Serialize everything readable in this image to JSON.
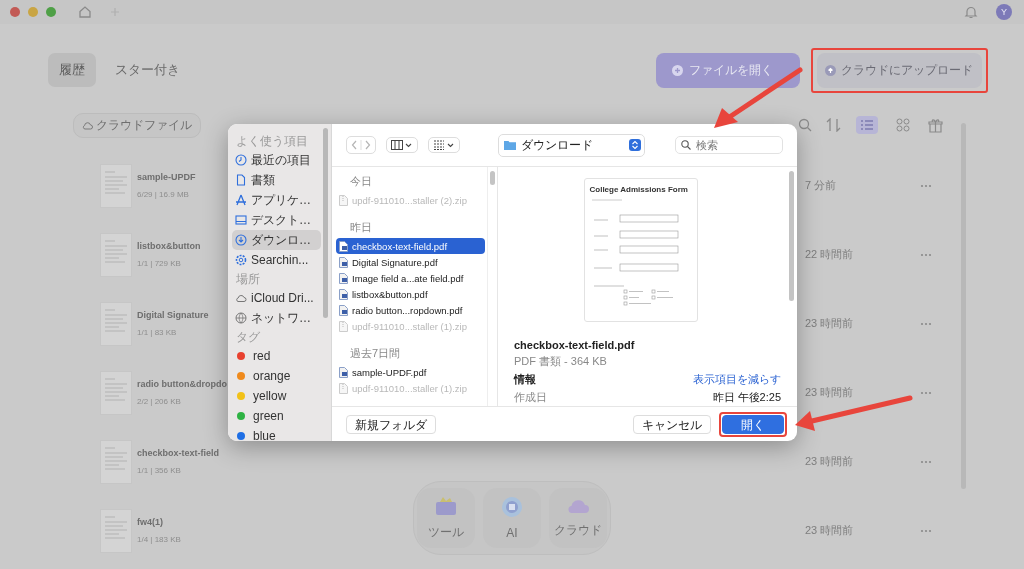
{
  "titlebar": {
    "avatar": "Y"
  },
  "tabs": [
    {
      "label": "履歴",
      "selected": true
    },
    {
      "label": "スター付き",
      "selected": false
    }
  ],
  "actions": [
    {
      "label": "ファイルを開く",
      "kind": "primary",
      "highlighted": false
    },
    {
      "label": "クラウドにアップロード",
      "kind": "secondary",
      "highlighted": true
    }
  ],
  "cloud_files": "クラウドファイル",
  "view_modes": [
    {
      "kind": "list",
      "selected": true
    },
    {
      "kind": "grid",
      "selected": false
    }
  ],
  "files": [
    {
      "name": "sample-UPDF",
      "meta": "6/29 | 16.9 MB",
      "time": "7 分前"
    },
    {
      "name": "listbox&button",
      "meta": "1/1 | 729 KB",
      "time": "22 時間前"
    },
    {
      "name": "Digital Signature",
      "meta": "1/1 | 83 KB",
      "time": "23 時間前"
    },
    {
      "name": "radio button&dropdo",
      "meta": "2/2 | 206 KB",
      "time": "23 時間前"
    },
    {
      "name": "checkbox-text-field",
      "meta": "1/1 | 356 KB",
      "time": "23 時間前"
    },
    {
      "name": "fw4(1)",
      "meta": "1/4 | 183 KB",
      "time": "23 時間前"
    }
  ],
  "dock": [
    {
      "label": "ツール",
      "kind": "tools"
    },
    {
      "label": "AI",
      "kind": "ai"
    },
    {
      "label": "クラウド",
      "kind": "cloud"
    }
  ],
  "dialog": {
    "sidebar": [
      {
        "heading": "よく使う項目",
        "items": [
          {
            "label": "最近の項目",
            "kind": "clock",
            "selected": false
          },
          {
            "label": "書類",
            "kind": "document",
            "selected": false
          },
          {
            "label": "アプリケ…",
            "kind": "apps",
            "selected": false
          },
          {
            "label": "デスクト…",
            "kind": "desktop",
            "selected": false
          },
          {
            "label": "ダウンロ…",
            "kind": "download",
            "selected": true
          },
          {
            "label": "Searchin...",
            "kind": "gear",
            "selected": false
          }
        ]
      },
      {
        "heading": "場所",
        "items": [
          {
            "label": "iCloud Dri...",
            "kind": "cloud",
            "selected": false
          },
          {
            "label": "ネットワ…",
            "kind": "globe",
            "selected": false
          }
        ]
      },
      {
        "heading": "タグ",
        "items": [
          {
            "label": "red",
            "kind": "tag",
            "color": "#e8412f",
            "selected": false
          },
          {
            "label": "orange",
            "kind": "tag",
            "color": "#ef8a1c",
            "selected": false
          },
          {
            "label": "yellow",
            "kind": "tag",
            "color": "#f2c118",
            "selected": false
          },
          {
            "label": "green",
            "kind": "tag",
            "color": "#2fb344",
            "selected": false
          },
          {
            "label": "blue",
            "kind": "tag",
            "color": "#1f6fe5",
            "selected": false
          }
        ]
      }
    ],
    "location": "ダウンロード",
    "search_placeholder": "検索",
    "groups": [
      {
        "heading": "今日",
        "files": [
          {
            "name": "updf-911010...staller (2).zip",
            "kind": "zip",
            "disabled": true,
            "selected": false
          }
        ]
      },
      {
        "heading": "昨日",
        "files": [
          {
            "name": "checkbox-text-field.pdf",
            "kind": "pdf",
            "disabled": false,
            "selected": true
          },
          {
            "name": "Digital Signature.pdf",
            "kind": "pdf",
            "disabled": false,
            "selected": false
          },
          {
            "name": "Image field a...ate field.pdf",
            "kind": "pdf",
            "disabled": false,
            "selected": false
          },
          {
            "name": "listbox&button.pdf",
            "kind": "pdf",
            "disabled": false,
            "selected": false
          },
          {
            "name": "radio button...ropdown.pdf",
            "kind": "pdf",
            "disabled": false,
            "selected": false
          },
          {
            "name": "updf-911010...staller (1).zip",
            "kind": "zip",
            "disabled": true,
            "selected": false
          }
        ]
      },
      {
        "heading": "過去7日間",
        "files": [
          {
            "name": "sample-UPDF.pdf",
            "kind": "pdf",
            "disabled": false,
            "selected": false
          },
          {
            "name": "updf-911010...staller (1).zip",
            "kind": "zip",
            "disabled": true,
            "selected": false
          }
        ]
      }
    ],
    "preview": {
      "document_title": "College Admissions Form",
      "name": "checkbox-text-field.pdf",
      "type_size": "PDF 書類 - 364 KB",
      "info_heading": "情報",
      "less_link": "表示項目を減らす",
      "fields": [
        {
          "label": "作成日",
          "value": "昨日 午後2:25"
        }
      ]
    },
    "buttons": [
      {
        "label": "新規フォルダ",
        "kind": "secondary",
        "highlighted": false
      },
      {
        "label": "キャンセル",
        "kind": "secondary",
        "highlighted": false
      },
      {
        "label": "開く",
        "kind": "primary",
        "highlighted": true
      }
    ]
  }
}
